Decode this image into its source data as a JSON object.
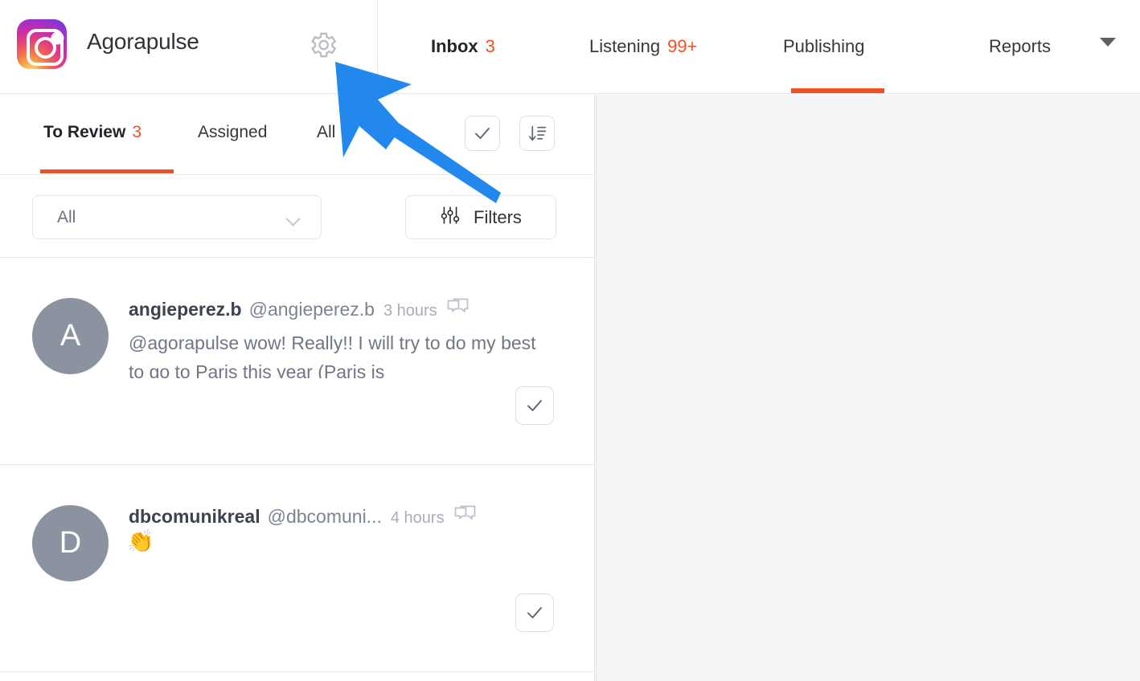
{
  "brand": {
    "logo_icon": "instagram-logo-icon",
    "name": "Agorapulse",
    "settings_icon": "gear-icon"
  },
  "nav": {
    "items": [
      {
        "label": "Inbox",
        "badge": "3",
        "active": true
      },
      {
        "label": "Listening",
        "badge": "99+",
        "active": false
      },
      {
        "label": "Publishing",
        "badge": "",
        "active": false
      },
      {
        "label": "Reports",
        "badge": "",
        "active": false
      }
    ],
    "caret_icon": "chevron-down-icon",
    "accent_color": "#ef5125"
  },
  "subtabs": {
    "items": [
      {
        "label": "To Review",
        "badge": "3",
        "active": true
      },
      {
        "label": "Assigned",
        "badge": "",
        "active": false
      },
      {
        "label": "All",
        "badge": "",
        "active": false
      }
    ],
    "check_all_icon": "check-icon",
    "sort_icon": "sort-descending-icon"
  },
  "filters": {
    "select_value": "All",
    "select_chevron_icon": "chevron-down-icon",
    "filters_label": "Filters",
    "filters_icon": "sliders-icon"
  },
  "messages": [
    {
      "avatar_letter": "A",
      "name": "angieperez.b",
      "handle": "@angieperez.b",
      "time": "3 hours",
      "comment_icon": "comment-bubble-icon",
      "body": "@agorapulse wow! Really!! I will try to do my best to go to Paris this year (Paris is",
      "emoji": "",
      "check_icon": "check-icon"
    },
    {
      "avatar_letter": "D",
      "name": "dbcomunikreal",
      "handle": "@dbcomuni...",
      "time": "4 hours",
      "comment_icon": "comment-bubble-icon",
      "body": "",
      "emoji": "👏",
      "check_icon": "check-icon"
    }
  ],
  "annotation": {
    "arrow_icon": "blue-arrow-pointer",
    "color": "#2288ee"
  }
}
